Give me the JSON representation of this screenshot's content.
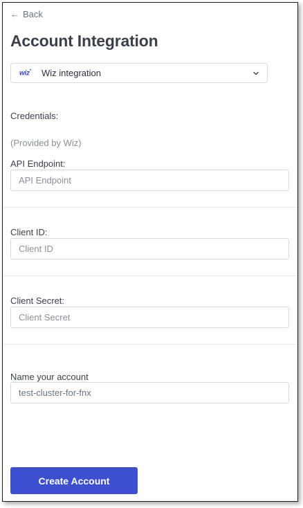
{
  "back": {
    "label": "Back"
  },
  "page_title": "Account Integration",
  "integration_select": {
    "logo_text": "wiz",
    "value": "Wiz integration"
  },
  "credentials": {
    "heading": "Credentials:",
    "provided_by": "(Provided by Wiz)"
  },
  "fields": {
    "api_endpoint": {
      "label": "API Endpoint:",
      "placeholder": "API Endpoint",
      "value": ""
    },
    "client_id": {
      "label": "Client ID:",
      "placeholder": "Client ID",
      "value": ""
    },
    "client_secret": {
      "label": "Client Secret:",
      "placeholder": "Client Secret",
      "value": ""
    },
    "account_name": {
      "label": "Name your account",
      "placeholder": "",
      "value": "test-cluster-for-fnx"
    }
  },
  "actions": {
    "create_label": "Create Account"
  },
  "colors": {
    "primary": "#3c4fd1",
    "wiz_brand": "#2f44d6",
    "muted_text": "#8b9099",
    "border": "#d6d9de"
  }
}
